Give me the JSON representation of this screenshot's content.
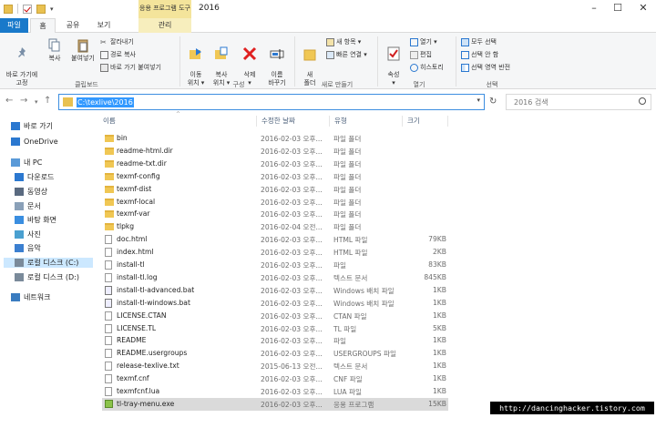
{
  "window": {
    "title": "2016",
    "context_tab": "응용 프로그램 도구",
    "controls": {
      "minimize": "–",
      "maximize": "☐",
      "close": "✕"
    }
  },
  "tabs": {
    "file": "파일",
    "home": "홈",
    "share": "공유",
    "view": "보기",
    "manage": "관리"
  },
  "ribbon": {
    "pin_quick": "바로 가기에\n고정",
    "copy": "복사",
    "paste": "붙여넣기",
    "cut": "잘라내기",
    "copy_path": "경로 복사",
    "paste_shortcut": "바로 가기 붙여넣기",
    "move_to": "이동\n위치 ▾",
    "copy_to": "복사\n위치 ▾",
    "delete": "삭제\n▾",
    "rename": "이름\n바꾸기",
    "new_folder": "새\n폴더",
    "new_item": "새 항목 ▾",
    "easy_access": "빠른 연결 ▾",
    "properties": "속성\n▾",
    "open": "열기 ▾",
    "edit": "편집",
    "history": "히스토리",
    "select_all": "모두 선택",
    "select_none": "선택 안 함",
    "invert_selection": "선택 영역 반전",
    "groups": {
      "clipboard": "클립보드",
      "organize": "구성",
      "new": "새로 만들기",
      "open": "열기",
      "select": "선택"
    }
  },
  "address": {
    "path": "C:\\texlive\\2016",
    "search_placeholder": "2016 검색"
  },
  "nav": [
    {
      "label": "바로 가기",
      "icon": "star-icon",
      "name": "nav-quick-access"
    },
    {
      "label": "OneDrive",
      "icon": "cloud-icon",
      "name": "nav-onedrive"
    },
    {
      "label": "내 PC",
      "icon": "pc-icon",
      "name": "nav-this-pc"
    },
    {
      "label": "다운로드",
      "icon": "download-icon",
      "name": "nav-downloads"
    },
    {
      "label": "동영상",
      "icon": "video-icon",
      "name": "nav-videos"
    },
    {
      "label": "문서",
      "icon": "document-icon",
      "name": "nav-documents"
    },
    {
      "label": "바탕 화면",
      "icon": "desktop-icon",
      "name": "nav-desktop"
    },
    {
      "label": "사진",
      "icon": "picture-icon",
      "name": "nav-pictures"
    },
    {
      "label": "음악",
      "icon": "music-icon",
      "name": "nav-music"
    },
    {
      "label": "로컬 디스크 (C:)",
      "icon": "drive-icon",
      "name": "nav-drive-c"
    },
    {
      "label": "로컬 디스크 (D:)",
      "icon": "drive-icon",
      "name": "nav-drive-d"
    },
    {
      "label": "네트워크",
      "icon": "network-icon",
      "name": "nav-network"
    }
  ],
  "columns": {
    "name": "이름",
    "date": "수정한 날짜",
    "type": "유형",
    "size": "크기"
  },
  "files": [
    {
      "name": "bin",
      "date": "2016-02-03 오후...",
      "type": "파일 폴더",
      "size": "",
      "kind": "folder"
    },
    {
      "name": "readme-html.dir",
      "date": "2016-02-03 오후...",
      "type": "파일 폴더",
      "size": "",
      "kind": "folder"
    },
    {
      "name": "readme-txt.dir",
      "date": "2016-02-03 오후...",
      "type": "파일 폴더",
      "size": "",
      "kind": "folder"
    },
    {
      "name": "texmf-config",
      "date": "2016-02-03 오후...",
      "type": "파일 폴더",
      "size": "",
      "kind": "folder"
    },
    {
      "name": "texmf-dist",
      "date": "2016-02-03 오후...",
      "type": "파일 폴더",
      "size": "",
      "kind": "folder"
    },
    {
      "name": "texmf-local",
      "date": "2016-02-03 오후...",
      "type": "파일 폴더",
      "size": "",
      "kind": "folder"
    },
    {
      "name": "texmf-var",
      "date": "2016-02-03 오후...",
      "type": "파일 폴더",
      "size": "",
      "kind": "folder"
    },
    {
      "name": "tlpkg",
      "date": "2016-02-04 오전...",
      "type": "파일 폴더",
      "size": "",
      "kind": "folder"
    },
    {
      "name": "doc.html",
      "date": "2016-02-03 오후...",
      "type": "HTML 파일",
      "size": "79KB",
      "kind": "file"
    },
    {
      "name": "index.html",
      "date": "2016-02-03 오후...",
      "type": "HTML 파일",
      "size": "2KB",
      "kind": "file"
    },
    {
      "name": "install-tl",
      "date": "2016-02-03 오후...",
      "type": "파일",
      "size": "83KB",
      "kind": "file"
    },
    {
      "name": "install-tl.log",
      "date": "2016-02-03 오후...",
      "type": "텍스트 문서",
      "size": "845KB",
      "kind": "file"
    },
    {
      "name": "install-tl-advanced.bat",
      "date": "2016-02-03 오후...",
      "type": "Windows 배치 파일",
      "size": "1KB",
      "kind": "bat"
    },
    {
      "name": "install-tl-windows.bat",
      "date": "2016-02-03 오후...",
      "type": "Windows 배치 파일",
      "size": "1KB",
      "kind": "bat"
    },
    {
      "name": "LICENSE.CTAN",
      "date": "2016-02-03 오후...",
      "type": "CTAN 파일",
      "size": "1KB",
      "kind": "file"
    },
    {
      "name": "LICENSE.TL",
      "date": "2016-02-03 오후...",
      "type": "TL 파일",
      "size": "5KB",
      "kind": "file"
    },
    {
      "name": "README",
      "date": "2016-02-03 오후...",
      "type": "파일",
      "size": "1KB",
      "kind": "file"
    },
    {
      "name": "README.usergroups",
      "date": "2016-02-03 오후...",
      "type": "USERGROUPS 파일",
      "size": "1KB",
      "kind": "file"
    },
    {
      "name": "release-texlive.txt",
      "date": "2015-06-13 오전...",
      "type": "텍스트 문서",
      "size": "1KB",
      "kind": "file"
    },
    {
      "name": "texmf.cnf",
      "date": "2016-02-03 오후...",
      "type": "CNF 파일",
      "size": "1KB",
      "kind": "file"
    },
    {
      "name": "texmfcnf.lua",
      "date": "2016-02-03 오후...",
      "type": "LUA 파일",
      "size": "1KB",
      "kind": "file"
    },
    {
      "name": "tl-tray-menu.exe",
      "date": "2016-02-03 오후...",
      "type": "응용 프로그램",
      "size": "15KB",
      "kind": "exe",
      "selected": true
    }
  ],
  "watermark": "http://dancinghacker.tistory.com",
  "colors": {
    "file_tab": "#1979ca",
    "context_tab": "#f4e49b",
    "selection": "#dadada",
    "address_highlight": "#3399ff"
  }
}
